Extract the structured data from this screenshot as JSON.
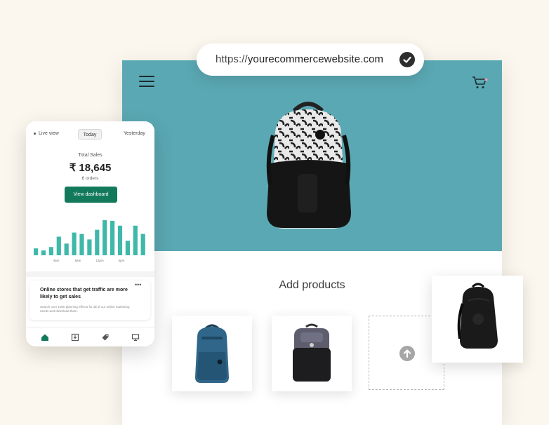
{
  "url_bar": {
    "protocol": "https://",
    "domain": "yourecommercewebsite.com",
    "verified_icon": "check-circle-icon"
  },
  "store": {
    "menu_icon": "hamburger-icon",
    "cart_icon": "cart-icon",
    "hero_color": "#5aa8b3",
    "add_products_title": "Add products",
    "upload_icon": "upload-arrow-icon"
  },
  "dashboard": {
    "segments": [
      "Live view",
      "Today",
      "Yesterday"
    ],
    "selected_segment": "Today",
    "total_sales_label": "Total Sales",
    "total_sales_value": "₹ 18,645",
    "orders": "6 orders",
    "button_label": "View dashboard",
    "accent": "#127a5b",
    "bar_color": "#3fb8a9"
  },
  "chart_data": {
    "type": "bar",
    "values": [
      10,
      7,
      12,
      27,
      17,
      33,
      31,
      23,
      37,
      51,
      50,
      43,
      21,
      43,
      31
    ],
    "x_ticks": [
      "4am",
      "8am",
      "12pm",
      "4pm"
    ],
    "ylim": [
      0,
      55
    ]
  },
  "tip": {
    "title": "Online stores that get traffic are more likely to get sales",
    "body": "Search over 1000 planning effects for all of our online marketing needs and download them.",
    "more_icon": "more-horizontal-icon"
  },
  "bottom_nav": [
    "home-icon",
    "orders-icon",
    "tag-icon",
    "store-icon"
  ]
}
